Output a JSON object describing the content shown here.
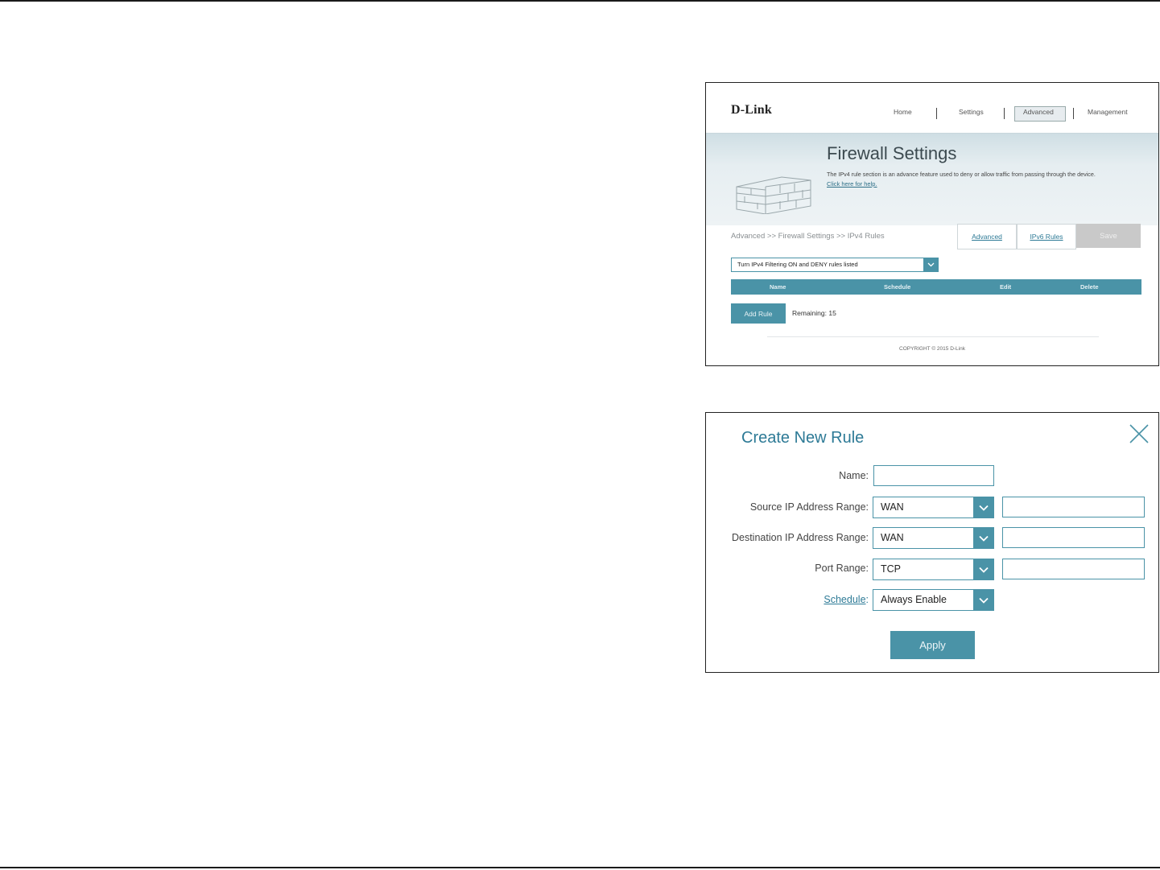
{
  "colors": {
    "accent": "#4a93a7",
    "link": "#2d7a96",
    "save_disabled": "#c9c9c9"
  },
  "firewall": {
    "logo": "D-Link",
    "nav": {
      "home": "Home",
      "settings": "Settings",
      "advanced": "Advanced",
      "management": "Management"
    },
    "title": "Firewall Settings",
    "description": "The IPv4 rule section is an advance feature used to deny or allow traffic from passing through the device.",
    "help_link": "Click here for help.",
    "breadcrumb": "Advanced >> Firewall Settings >> IPv4 Rules",
    "tabs": {
      "advanced": "Advanced",
      "ipv6": "IPv6 Rules",
      "save": "Save"
    },
    "filter_select": "Turn IPv4 Filtering ON and DENY rules listed",
    "table_headers": {
      "name": "Name",
      "schedule": "Schedule",
      "edit": "Edit",
      "delete": "Delete"
    },
    "add_rule": "Add Rule",
    "remaining": "Remaining: 15",
    "copyright": "COPYRIGHT © 2015 D-Link",
    "icons": {
      "wall": "brick-wall-icon",
      "dropdown": "chevron-down-icon"
    }
  },
  "dialog": {
    "title": "Create New Rule",
    "labels": {
      "name": "Name:",
      "source": "Source IP Address Range:",
      "destination": "Destination IP Address Range:",
      "port": "Port Range:",
      "schedule": "Schedule",
      "schedule_colon": ":"
    },
    "values": {
      "name": "",
      "source_type": "WAN",
      "source_ip": "",
      "destination_type": "WAN",
      "destination_ip": "",
      "port_protocol": "TCP",
      "port_range": "",
      "schedule": "Always Enable"
    },
    "apply": "Apply",
    "icons": {
      "close": "close-icon",
      "dropdown": "chevron-down-icon"
    }
  }
}
